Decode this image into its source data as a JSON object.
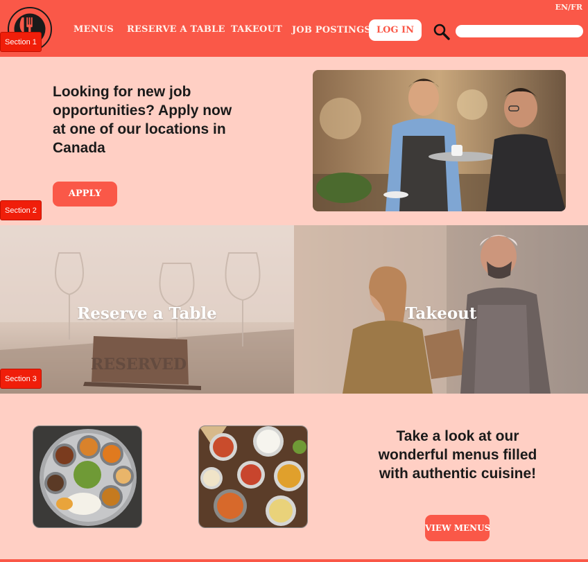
{
  "header": {
    "nav": {
      "menus": "MENUS",
      "reserve": "RESERVE A TABLE",
      "takeout": "TAKEOUT",
      "jobs": "JOB POSTINGS"
    },
    "login_label": "LOG IN",
    "language_toggle": "EN/FR",
    "search_placeholder": "",
    "search_icon": "search-icon",
    "logo_icon": "fork-knife-logo"
  },
  "section_tags": [
    "Section 1",
    "Section 2",
    "Section 3"
  ],
  "jobs": {
    "headline": "Looking for new job opportunities? Apply now at one of our locations in Canada",
    "apply_label": "APPLY"
  },
  "features": {
    "reserve_title": "Reserve a Table",
    "reserved_sign": "RESERVED",
    "takeout_title": "Takeout"
  },
  "menus_promo": {
    "headline": "Take a look at our wonderful menus filled with authentic cuisine!",
    "button_label": "VIEW MENUS"
  },
  "colors": {
    "brand": "#fa5848",
    "background": "#ffcfc4",
    "tag": "#f01e0a"
  }
}
